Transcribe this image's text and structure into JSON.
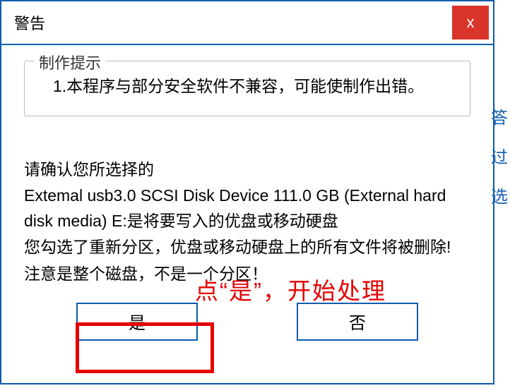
{
  "dialog": {
    "title": "警告",
    "close_label": "x"
  },
  "notice": {
    "legend": "制作提示",
    "text": "1.本程序与部分安全软件不兼容，可能使制作出错。"
  },
  "body": {
    "line1": "请确认您所选择的",
    "line2": "Extemal usb3.0 SCSI Disk Device 111.0 GB (External hard disk media) E:是将要写入的优盘或移动硬盘",
    "line3": "您勾选了重新分区，优盘或移动硬盘上的所有文件将被删除!",
    "line4": "注意是整个磁盘，不是一个分区！"
  },
  "buttons": {
    "yes": "是",
    "no": "否"
  },
  "annotation": {
    "text": "点“是”，开始处理"
  },
  "fragments": {
    "f1": "答",
    "f2": "过",
    "f3": "选"
  }
}
